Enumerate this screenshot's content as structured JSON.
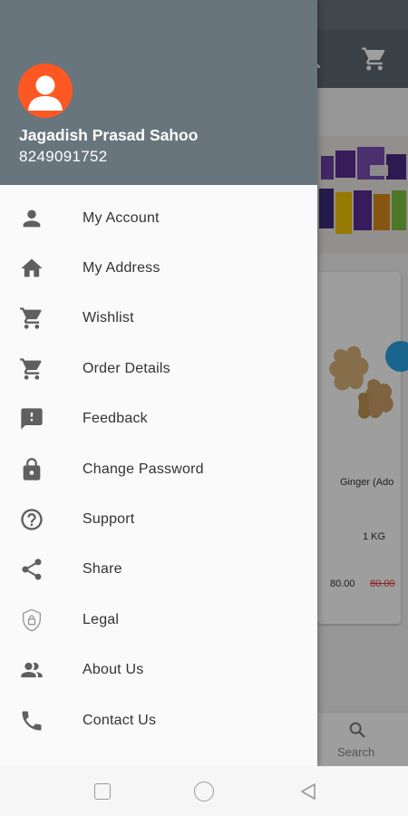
{
  "user": {
    "name": "Jagadish Prasad Sahoo",
    "phone": "8249091752"
  },
  "menu": [
    {
      "label": "My Account",
      "icon": "person-icon"
    },
    {
      "label": "My Address",
      "icon": "home-icon"
    },
    {
      "label": "Wishlist",
      "icon": "cart-icon"
    },
    {
      "label": "Order Details",
      "icon": "cart-icon"
    },
    {
      "label": "Feedback",
      "icon": "feedback-icon"
    },
    {
      "label": "Change Password",
      "icon": "lock-icon"
    },
    {
      "label": "Support",
      "icon": "help-circle-icon"
    },
    {
      "label": "Share",
      "icon": "share-icon"
    },
    {
      "label": "Legal",
      "icon": "shield-lock-icon"
    },
    {
      "label": "About Us",
      "icon": "people-icon"
    },
    {
      "label": "Contact Us",
      "icon": "phone-icon"
    }
  ],
  "background_app": {
    "product_name": "Ginger (Ado",
    "product_qty": "1 KG",
    "price": "80.00",
    "mrp": "80.00",
    "bottom_nav_label": "Search"
  },
  "colors": {
    "header": "#68757c",
    "avatar": "#ff5722",
    "icon": "#5f5f5f",
    "mrp": "#e53935"
  }
}
